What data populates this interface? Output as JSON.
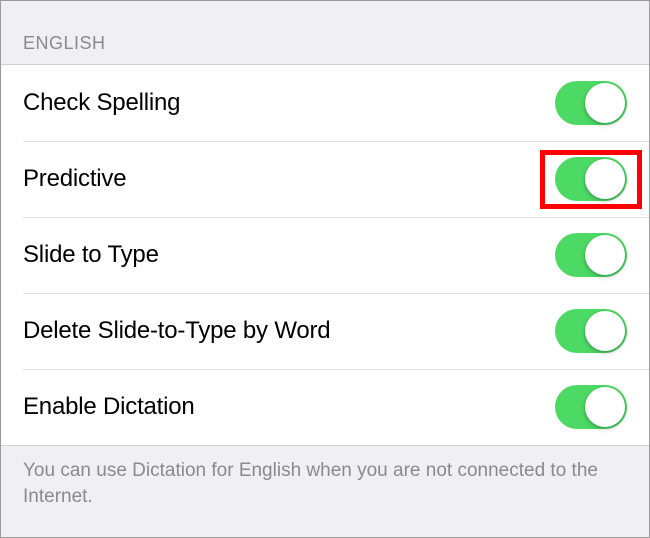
{
  "section": {
    "header": "English"
  },
  "rows": [
    {
      "label": "Check Spelling",
      "on": true,
      "highlighted": false
    },
    {
      "label": "Predictive",
      "on": true,
      "highlighted": true
    },
    {
      "label": "Slide to Type",
      "on": true,
      "highlighted": false
    },
    {
      "label": "Delete Slide-to-Type by Word",
      "on": true,
      "highlighted": false
    },
    {
      "label": "Enable Dictation",
      "on": true,
      "highlighted": false
    }
  ],
  "footer": "You can use Dictation for English when you are not connected to the Internet.",
  "colors": {
    "toggle_on": "#4cd964",
    "highlight": "#ff0000"
  }
}
